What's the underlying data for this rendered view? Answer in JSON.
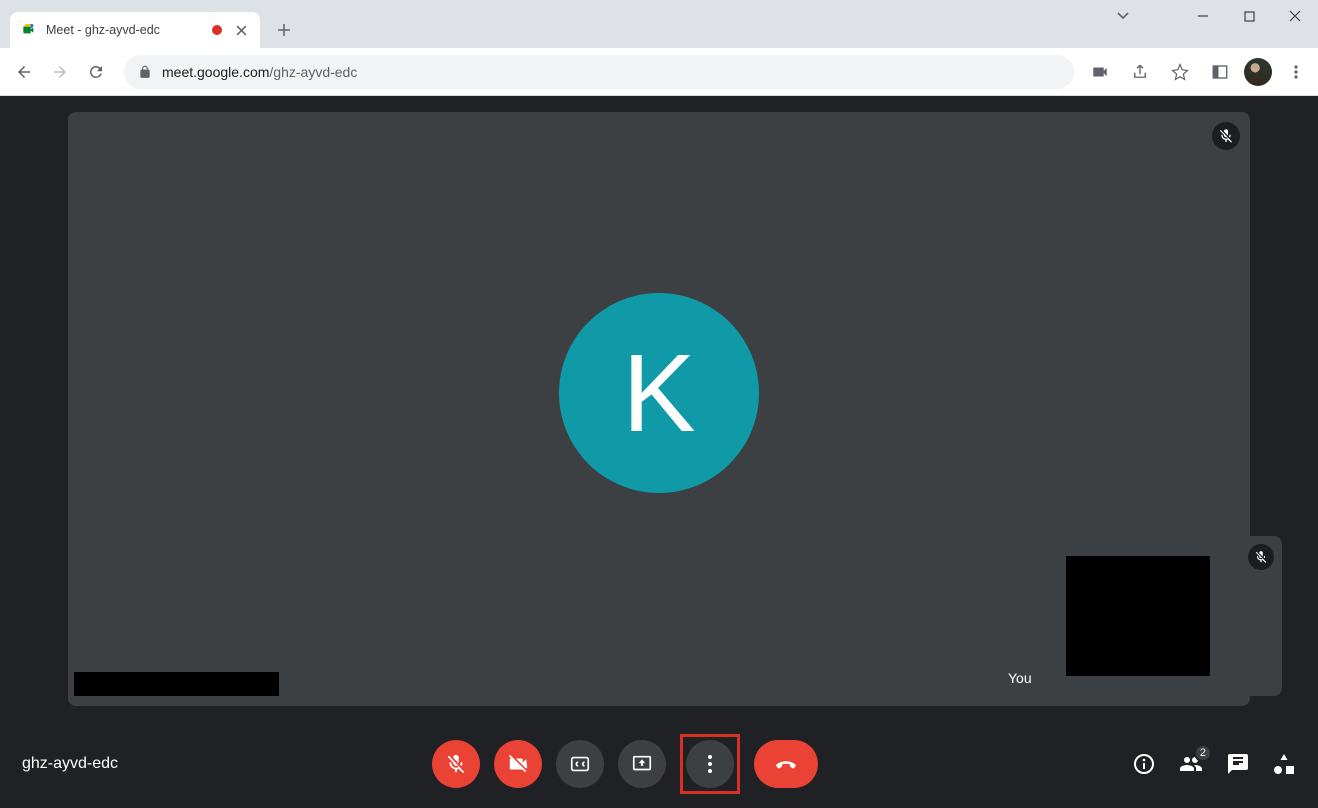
{
  "browser": {
    "tab_title": "Meet - ghz-ayvd-edc",
    "url_domain": "meet.google.com",
    "url_path": "/ghz-ayvd-edc"
  },
  "meet": {
    "meeting_code": "ghz-ayvd-edc",
    "main_participant_initial": "K",
    "main_participant_avatar_color": "#109aa8",
    "self_label": "You",
    "participant_count_badge": "2"
  }
}
